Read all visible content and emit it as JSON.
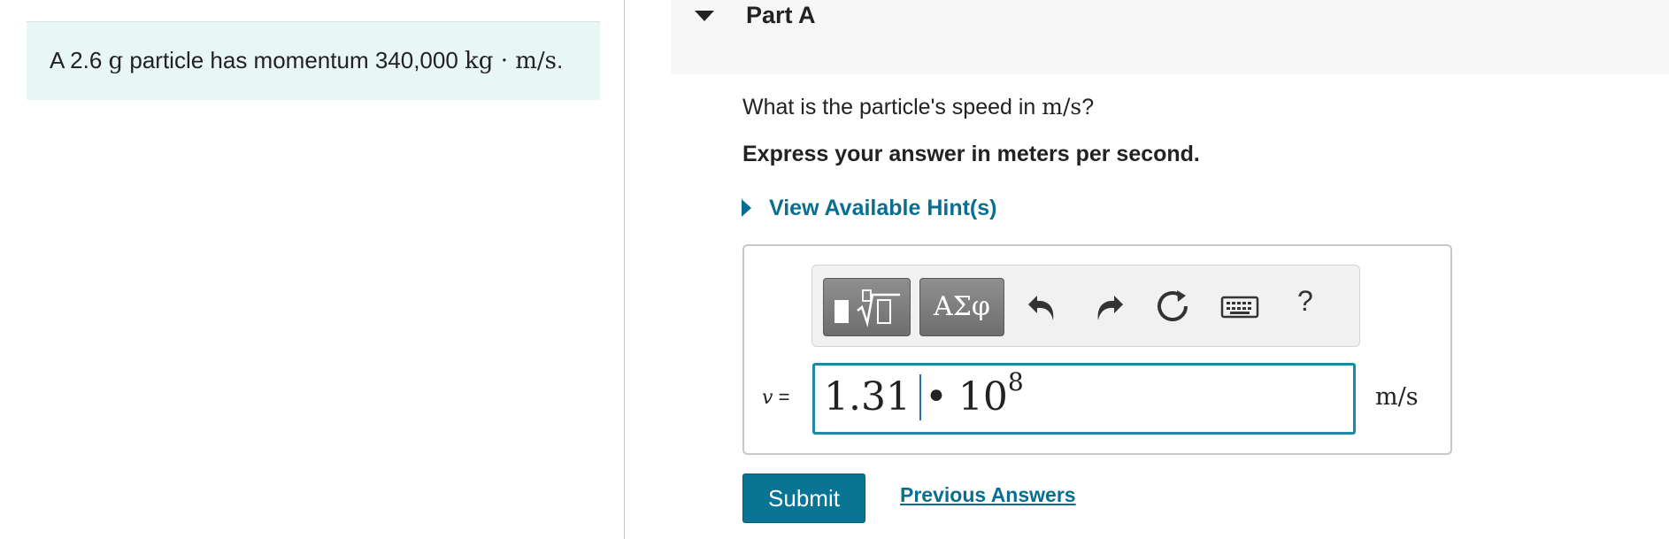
{
  "problem": {
    "text_prefix": "A 2.6 ",
    "mass_unit": "g",
    "text_mid": " particle has momentum 340,000 ",
    "momentum_unit": "kg · m/s",
    "text_suffix": "."
  },
  "part": {
    "title": "Part A"
  },
  "question": {
    "text": "What is the particle's speed in ",
    "unit": "m/s",
    "end": "?"
  },
  "instruction": "Express your answer in meters per second.",
  "hints": {
    "label": "View Available Hint(s)"
  },
  "toolbar": {
    "greek_label": "ΑΣφ",
    "help_label": "?",
    "icons": [
      "templates-icon",
      "greek-letters-icon",
      "undo-icon",
      "redo-icon",
      "reset-icon",
      "keyboard-icon",
      "help-icon"
    ]
  },
  "answer": {
    "variable": "v",
    "equals": "=",
    "mantissa": "1.31",
    "operator": "•",
    "base": "10",
    "exponent": "8",
    "unit": "m/s"
  },
  "actions": {
    "submit_label": "Submit",
    "previous_answers_label": "Previous Answers"
  },
  "colors": {
    "accent": "#0a7495",
    "link": "#0a6f8f",
    "problem_bg": "#e8f6f5",
    "input_border": "#1c89a6"
  }
}
